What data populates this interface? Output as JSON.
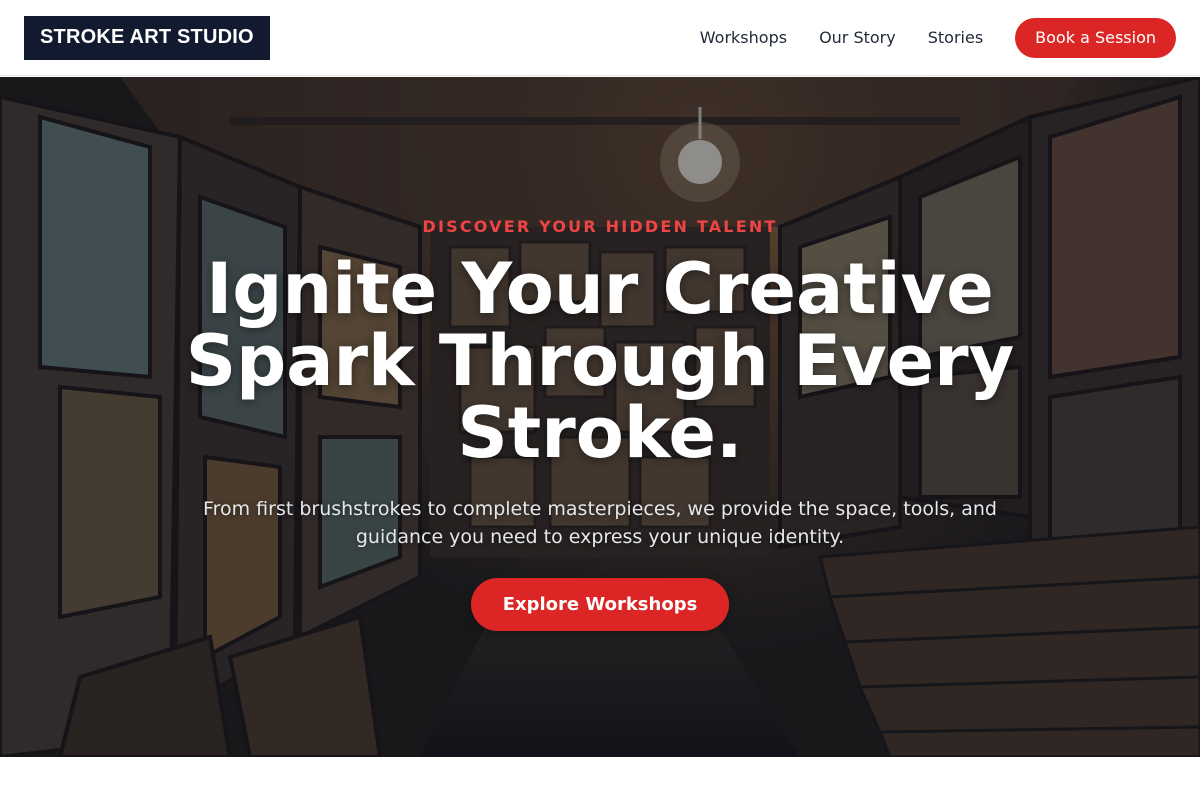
{
  "header": {
    "logo_text": "STROKE ART STUDIO",
    "nav": [
      {
        "label": "Workshops"
      },
      {
        "label": "Our Story"
      },
      {
        "label": "Stories"
      }
    ],
    "cta_label": "Book a Session"
  },
  "hero": {
    "eyebrow": "DISCOVER YOUR HIDDEN TALENT",
    "headline": "Ignite Your Creative Spark Through Every Stroke.",
    "subtext": "From first brushstrokes to complete masterpieces, we provide the space, tools, and guidance you need to express your unique identity.",
    "button_label": "Explore Workshops",
    "background_image": "art-studio-gallery-photo"
  },
  "colors": {
    "accent": "#dc2626",
    "eyebrow": "#ef4444",
    "logo_bg": "#111a2e"
  }
}
